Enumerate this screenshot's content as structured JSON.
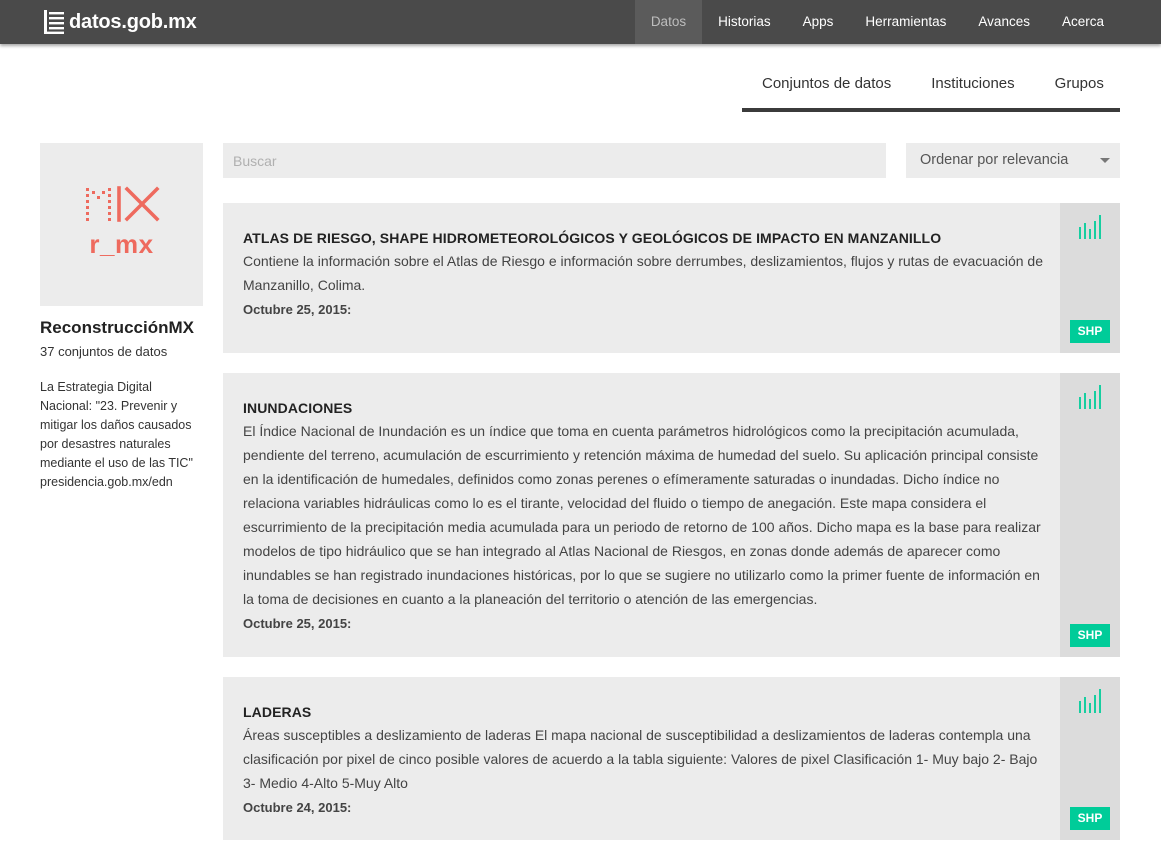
{
  "header": {
    "brand": "datos.gob.mx",
    "nav": [
      {
        "label": "Datos",
        "active": true
      },
      {
        "label": "Historias"
      },
      {
        "label": "Apps"
      },
      {
        "label": "Herramientas"
      },
      {
        "label": "Avances"
      },
      {
        "label": "Acerca"
      }
    ]
  },
  "subnav": {
    "items": [
      "Conjuntos de datos",
      "Instituciones",
      "Grupos"
    ]
  },
  "organization": {
    "logo_text": "r_mx",
    "logo_color": "#ee6a5e",
    "name": "ReconstrucciónMX",
    "dataset_count": "37 conjuntos de datos",
    "description": "La Estrategia Digital Nacional: \"23. Prevenir y mitigar los daños causados por desastres naturales mediante el uso de las TIC\" presidencia.gob.mx/edn"
  },
  "search": {
    "placeholder": "Buscar",
    "value": ""
  },
  "sort": {
    "selected": "Ordenar por relevancia"
  },
  "accent_color": "#00cc99",
  "datasets": [
    {
      "title": "ATLAS DE RIESGO, SHAPE HIDROMETEOROLÓGICOS Y GEOLÓGICOS DE IMPACTO EN MANZANILLO",
      "description": "Contiene la información sobre el Atlas de Riesgo e información sobre derrumbes, deslizamientos, flujos y rutas de evacuación de Manzanillo, Colima.",
      "date": "Octubre 25, 2015:",
      "format": "SHP",
      "icon": "bar-chart-icon"
    },
    {
      "title": "INUNDACIONES",
      "description": "El Índice Nacional de Inundación es un índice que toma en cuenta parámetros hidrológicos como la precipitación acumulada, pendiente del terreno, acumulación de escurrimiento y retención máxima de humedad del suelo. Su aplicación principal consiste en la identificación de humedales, definidos como zonas perenes o efímeramente saturadas o inundadas. Dicho índice no relaciona variables hidráulicas como lo es el tirante, velocidad del fluido o tiempo de anegación. Este mapa considera el escurrimiento de la precipitación media acumulada para un periodo de retorno de 100 años. Dicho mapa es la base para realizar modelos de tipo hidráulico que se han integrado al Atlas Nacional de Riesgos, en zonas donde además de aparecer como inundables se han registrado inundaciones históricas, por lo que se sugiere no utilizarlo como la primer fuente de información en la toma de decisiones en cuanto a la planeación del territorio o atención de las emergencias.",
      "date": "Octubre 25, 2015:",
      "format": "SHP",
      "icon": "bar-chart-icon"
    },
    {
      "title": "LADERAS",
      "description": "Áreas susceptibles a deslizamiento de laderas  El mapa nacional de susceptibilidad a deslizamientos de laderas contempla una clasificación por pixel de cinco posible valores de acuerdo a la tabla siguiente:  Valores de pixel Clasificación 1- Muy bajo 2- Bajo 3- Medio 4-Alto 5-Muy Alto",
      "date": "Octubre 24, 2015:",
      "format": "SHP",
      "icon": "bar-chart-icon"
    }
  ]
}
